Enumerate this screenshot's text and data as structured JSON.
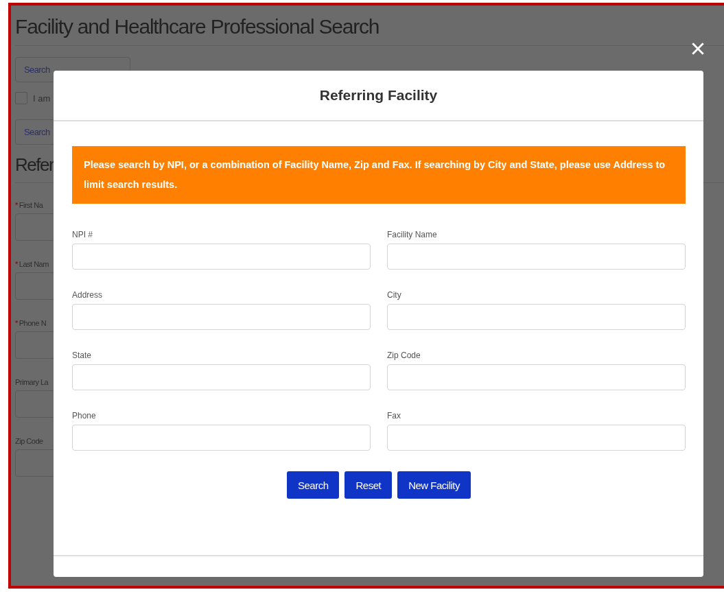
{
  "page": {
    "title": "Facility and Healthcare Professional Search",
    "buttons": [
      "Search",
      "Search"
    ],
    "checkbox": {
      "label": "I am",
      "checked": false
    },
    "section_title": "Refer",
    "fields": [
      {
        "mark": "*",
        "label": "First Na"
      },
      {
        "mark": "*",
        "label": "Last Nam"
      },
      {
        "mark": "*",
        "label": "Phone N"
      },
      {
        "label": "Primary La"
      },
      {
        "label": "Zip Code"
      }
    ]
  },
  "modal": {
    "title": "Referring Facility",
    "notice": "Please search by NPI, or a combination of Facility Name, Zip and Fax. If searching by City and State, please use Address to limit search results.",
    "fields": [
      {
        "label": "NPI #"
      },
      {
        "label": "Facility Name"
      },
      {
        "label": "Address"
      },
      {
        "label": "City"
      },
      {
        "label": "State"
      },
      {
        "label": "Zip Code"
      },
      {
        "label": "Phone"
      },
      {
        "label": "Fax"
      }
    ],
    "buttons": [
      "Search",
      "Reset",
      "New Facility"
    ]
  }
}
